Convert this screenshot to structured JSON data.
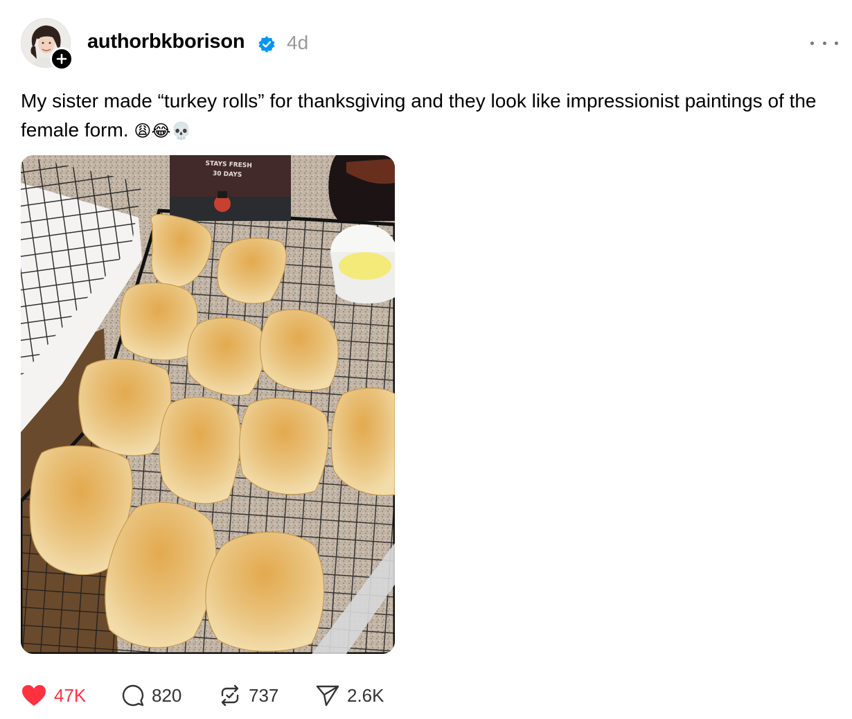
{
  "post": {
    "author": {
      "username": "authorbkborison",
      "verified": true,
      "avatar_icon": "avatar",
      "follow_icon": "plus-icon"
    },
    "timestamp": "4d",
    "more_icon": "more-icon",
    "caption": {
      "text": "My sister made “turkey rolls” for thanksgiving and they look like impressionist paintings of the female form.",
      "emojis": "😩😂💀"
    },
    "image": {
      "box_text_line1": "STAYS FRESH",
      "box_text_line2": "30 DAYS"
    },
    "actions": {
      "like": {
        "icon": "heart-icon",
        "count": "47K",
        "active": true,
        "color": "#ff3040"
      },
      "reply": {
        "icon": "comment-icon",
        "count": "820"
      },
      "repost": {
        "icon": "repost-icon",
        "count": "737"
      },
      "share": {
        "icon": "send-icon",
        "count": "2.6K"
      }
    }
  }
}
